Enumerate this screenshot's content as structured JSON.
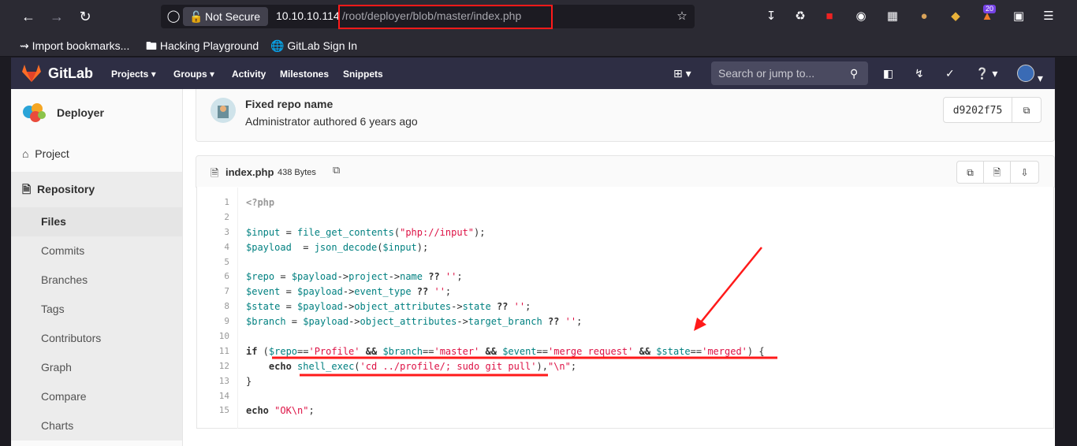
{
  "browser": {
    "not_secure_label": "Not Secure",
    "url_host": "10.10.10.114",
    "url_path": "/root/deployer/blob/master/index.php",
    "extension_badge": "20",
    "bookmarks": [
      {
        "label": "Import bookmarks..."
      },
      {
        "label": "Hacking Playground"
      },
      {
        "label": "GitLab Sign In"
      }
    ]
  },
  "gitlab": {
    "brand": "GitLab",
    "nav": [
      {
        "label": "Projects"
      },
      {
        "label": "Groups"
      },
      {
        "label": "Activity"
      },
      {
        "label": "Milestones"
      },
      {
        "label": "Snippets"
      }
    ],
    "search_placeholder": "Search or jump to..."
  },
  "sidebar": {
    "project_name": "Deployer",
    "items": [
      {
        "label": "Project"
      },
      {
        "label": "Repository"
      }
    ],
    "sub_items": [
      {
        "label": "Files"
      },
      {
        "label": "Commits"
      },
      {
        "label": "Branches"
      },
      {
        "label": "Tags"
      },
      {
        "label": "Contributors"
      },
      {
        "label": "Graph"
      },
      {
        "label": "Compare"
      },
      {
        "label": "Charts"
      }
    ]
  },
  "commit": {
    "title": "Fixed repo name",
    "author_line": "Administrator authored 6 years ago",
    "sha": "d9202f75"
  },
  "file": {
    "name": "index.php",
    "size": "438 Bytes"
  },
  "code_lines": [
    "1",
    "2",
    "3",
    "4",
    "5",
    "6",
    "7",
    "8",
    "9",
    "10",
    "11",
    "12",
    "13",
    "14",
    "15"
  ],
  "colors": {
    "accent": "#fc6d26",
    "annotation": "#ff1a1a"
  }
}
